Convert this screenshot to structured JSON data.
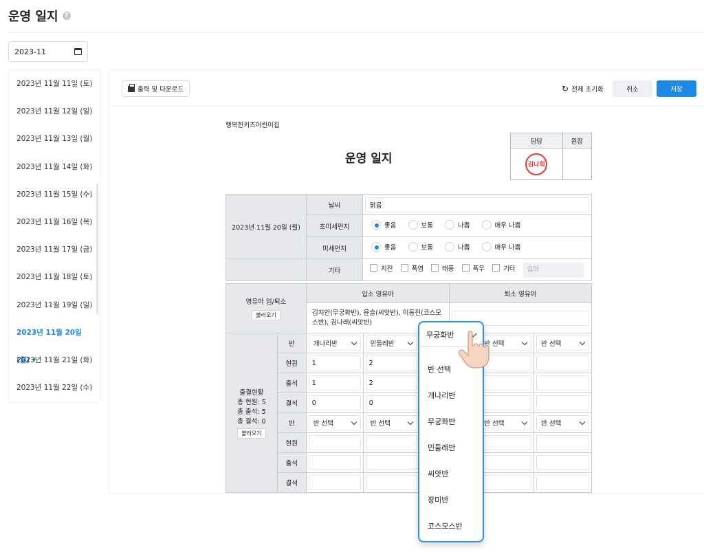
{
  "page": {
    "title": "운영 일지"
  },
  "month_picker": {
    "value": "2023-11"
  },
  "dates": [
    "2023년 11월 11일 (토)",
    "2023년 11월 12일 (일)",
    "2023년 11월 13일 (월)",
    "2023년 11월 14일 (화)",
    "2023년 11월 15일 (수)",
    "2023년 11월 16일 (목)",
    "2023년 11월 17일 (금)",
    "2023년 11월 18일 (토)",
    "2023년 11월 19일 (일)",
    "2023년 11월 20일 (월)",
    "2023년 11월 21일 (화)",
    "2023년 11월 22일 (수)"
  ],
  "toolbar": {
    "print_label": "출력 및 다운로드",
    "reset_label": "전체 초기화",
    "cancel_label": "취소",
    "save_label": "저장"
  },
  "doc": {
    "center_name": "행복한키즈어린이집",
    "title": "운영 일지",
    "approval": {
      "col1": "담당",
      "col2": "원장",
      "stamp": "김나희"
    }
  },
  "info": {
    "date": "2023년 11월 20일 (월)",
    "weather_label": "날씨",
    "weather_value": "맑음",
    "ultrafine_label": "초미세먼지",
    "fine_label": "미세먼지",
    "options": [
      "좋음",
      "보통",
      "나쁨",
      "매우 나쁨"
    ],
    "etc_label": "기타",
    "etc_checks": [
      "지진",
      "폭염",
      "태풍",
      "폭우",
      "기타"
    ],
    "etc_placeholder": "입력"
  },
  "kids": {
    "label": "영유아 입/퇴소",
    "load": "불러오기",
    "in_header": "입소 영유아",
    "out_header": "퇴소 영유아",
    "in_value": "김지안(무궁화반), 윤슬(씨앗반), 이동진(코스모스반), 김나래(씨앗반)"
  },
  "attendance": {
    "title": "출결현황",
    "total_enrolled": "총 현원: 5",
    "total_attend": "총 출석: 5",
    "total_absent": "총 결석: 0",
    "load": "불러오기",
    "row_labels": [
      "반",
      "현원",
      "출석",
      "결석"
    ],
    "block1": {
      "classes": [
        "개나리반",
        "민들레반",
        "",
        "반 선택",
        "반 선택"
      ],
      "enrolled": [
        "1",
        "2",
        "",
        "",
        ""
      ],
      "attend": [
        "1",
        "2",
        "",
        "",
        ""
      ],
      "absent": [
        "0",
        "0",
        "",
        "",
        ""
      ]
    },
    "block2": {
      "classes": [
        "반 선택",
        "반 선택",
        "",
        "반 선택",
        "반 선택"
      ]
    }
  },
  "dropdown": {
    "selected": "무궁화반",
    "options": [
      "반 선택",
      "개나리반",
      "무궁화반",
      "민들레반",
      "씨앗반",
      "장미반",
      "코스모스반"
    ]
  }
}
